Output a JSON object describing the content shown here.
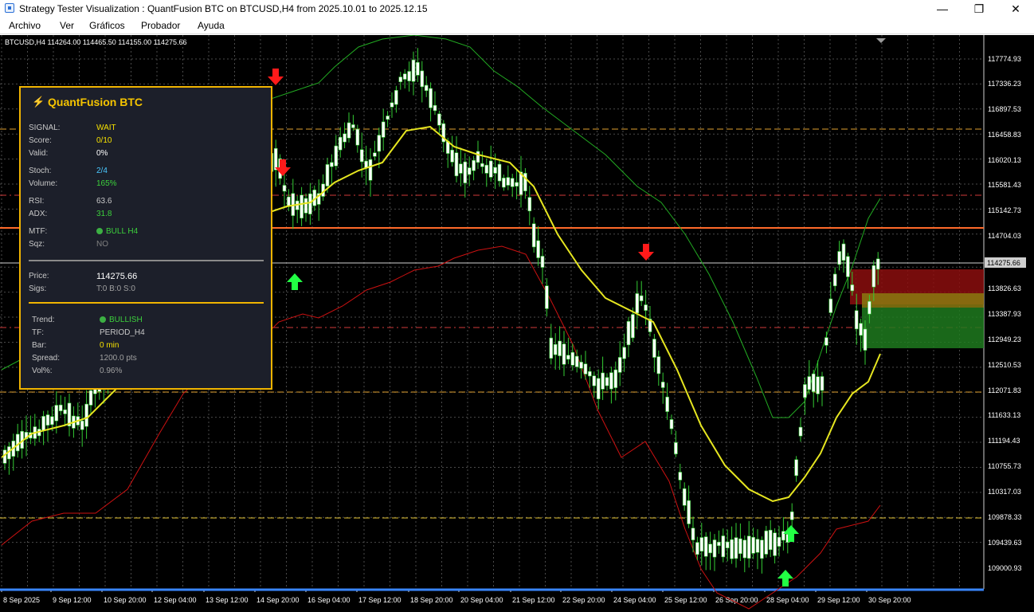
{
  "window": {
    "title": "Strategy Tester Visualization : QuantFusion BTC on BTCUSD,H4 from 2025.10.01 to 2025.12.15",
    "minimize": "—",
    "maximize": "❐",
    "close": "✕"
  },
  "menu": {
    "items": [
      "Archivo",
      "Ver",
      "Gráficos",
      "Probador",
      "Ayuda"
    ]
  },
  "symbol_info": "BTCUSD,H4  114264.00 114465.50 114155.00 114275.66",
  "panel": {
    "title": "QuantFusion BTC",
    "rows": {
      "signal": {
        "label": "SIGNAL:",
        "value": "WAIT"
      },
      "score": {
        "label": "Score:",
        "value": "0/10"
      },
      "valid": {
        "label": "Valid:",
        "value": "0%"
      },
      "stoch": {
        "label": "Stoch:",
        "value": "2/4"
      },
      "volume": {
        "label": "Volume:",
        "value": "165%"
      },
      "rsi": {
        "label": "RSI:",
        "value": "63.6"
      },
      "adx": {
        "label": "ADX:",
        "value": "31.8"
      },
      "mtf": {
        "label": "MTF:",
        "value": "BULL H4"
      },
      "sqz": {
        "label": "Sqz:",
        "value": "NO"
      },
      "price": {
        "label": "Price:",
        "value": "114275.66"
      },
      "sigs": {
        "label": "Sigs:",
        "value": "T:0 B:0 S:0"
      },
      "trend": {
        "label": "Trend:",
        "value": "BULLISH"
      },
      "tf": {
        "label": "TF:",
        "value": "PERIOD_H4"
      },
      "bar": {
        "label": "Bar:",
        "value": "0 min"
      },
      "spread": {
        "label": "Spread:",
        "value": "1200.0 pts"
      },
      "volp": {
        "label": "Vol%:",
        "value": "0.96%"
      }
    },
    "colors": {
      "title": "#f5c400",
      "yellow": "#f5e000",
      "green": "#3cd13c",
      "cyan": "#4ac8ff",
      "white": "#ffffff",
      "gray": "#a0a0a0"
    }
  },
  "chart": {
    "price_axis": [
      "117774.93",
      "117336.23",
      "116897.53",
      "116458.83",
      "116020.13",
      "115581.43",
      "115142.73",
      "114704.03",
      "114275.66",
      "113826.63",
      "113387.93",
      "112949.23",
      "112510.53",
      "112071.83",
      "111633.13",
      "111194.43",
      "110755.73",
      "110317.03",
      "109878.33",
      "109439.63",
      "109000.93"
    ],
    "current_price": "114275.66",
    "time_axis": [
      "8 Sep 2025",
      "9 Sep 12:00",
      "10 Sep 20:00",
      "12 Sep 04:00",
      "13 Sep 12:00",
      "14 Sep 20:00",
      "16 Sep 04:00",
      "17 Sep 12:00",
      "18 Sep 20:00",
      "20 Sep 04:00",
      "21 Sep 12:00",
      "22 Sep 20:00",
      "24 Sep 04:00",
      "25 Sep 12:00",
      "26 Sep 20:00",
      "28 Sep 04:00",
      "29 Sep 12:00",
      "30 Sep 20:00"
    ],
    "colors": {
      "bull_candle": "#ffffff",
      "wick": "#33cc33",
      "ma": "#e6e620",
      "upper_band": "#22aa22",
      "lower_band": "#cc1111",
      "grid": "#4a4a4a",
      "level_orange": "#ff6a2a",
      "level_blue": "#3a86ff"
    }
  }
}
